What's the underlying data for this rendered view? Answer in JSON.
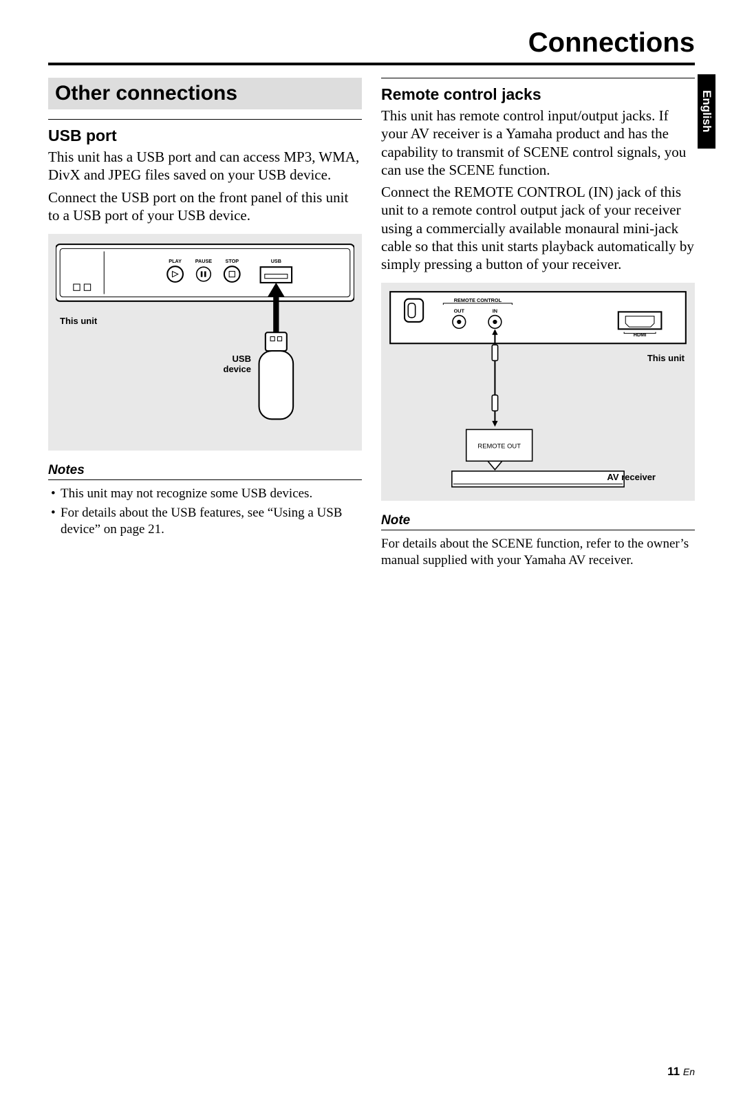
{
  "chapter_title": "Connections",
  "language_tab": "English",
  "page_number": "11",
  "page_suffix": "En",
  "left": {
    "section_title": "Other connections",
    "usb_heading": "USB port",
    "usb_p1": "This unit has a USB port and can access MP3, WMA, DivX and JPEG files saved on your USB device.",
    "usb_p2": "Connect the USB port on the front panel of this unit to a USB port of your USB device.",
    "diagram": {
      "play": "PLAY",
      "pause": "PAUSE",
      "stop": "STOP",
      "usb": "USB",
      "this_unit": "This unit",
      "usb_device_l1": "USB",
      "usb_device_l2": "device"
    },
    "notes_label": "Notes",
    "notes": [
      "This unit may not recognize some USB devices.",
      "For details about the USB features, see “Using a USB device” on page 21."
    ]
  },
  "right": {
    "remote_heading": "Remote control jacks",
    "remote_p1": "This unit has remote control input/output jacks. If your AV receiver is a Yamaha product and has the capability to transmit of SCENE control signals, you can use the SCENE function.",
    "remote_p2": "Connect the REMOTE CONTROL (IN) jack of this unit to a remote control output jack of your receiver using a commercially available monaural mini-jack cable so that this unit starts playback automatically by simply pressing a button of your receiver.",
    "diagram": {
      "remote_control": "REMOTE CONTROL",
      "out": "OUT",
      "in": "IN",
      "hdmi": "HDMI",
      "this_unit": "This unit",
      "remote_out": "REMOTE OUT",
      "av_receiver": "AV receiver"
    },
    "note_label": "Note",
    "note_text": "For details about the SCENE function, refer to the owner’s manual supplied with your Yamaha AV receiver."
  }
}
